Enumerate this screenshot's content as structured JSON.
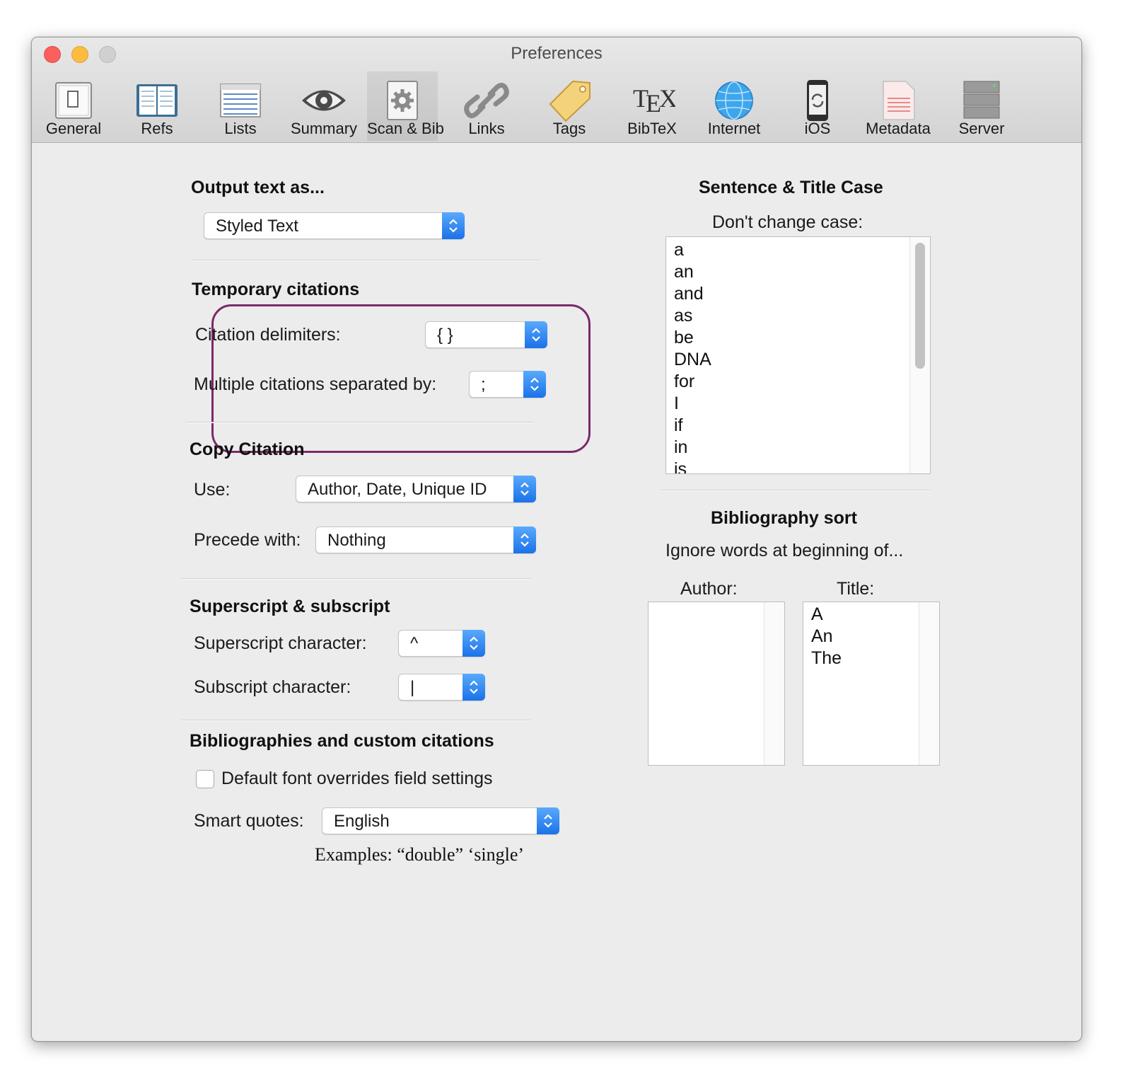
{
  "window": {
    "title": "Preferences"
  },
  "toolbar": [
    {
      "label": "General",
      "icon": "general-icon"
    },
    {
      "label": "Refs",
      "icon": "book-icon"
    },
    {
      "label": "Lists",
      "icon": "list-icon"
    },
    {
      "label": "Summary",
      "icon": "eye-icon"
    },
    {
      "label": "Scan & Bib",
      "icon": "gear-document-icon",
      "selected": true
    },
    {
      "label": "Links",
      "icon": "link-icon"
    },
    {
      "label": "Tags",
      "icon": "tag-icon"
    },
    {
      "label": "BibTeX",
      "icon": "tex-icon"
    },
    {
      "label": "Internet",
      "icon": "globe-icon"
    },
    {
      "label": "iOS",
      "icon": "phone-sync-icon"
    },
    {
      "label": "Metadata",
      "icon": "document-icon"
    },
    {
      "label": "Server",
      "icon": "server-icon"
    }
  ],
  "tex_logo": "TEX",
  "output": {
    "heading": "Output text as...",
    "value": "Styled Text"
  },
  "temporary_citations": {
    "heading": "Temporary citations",
    "delimiters_label": "Citation delimiters:",
    "delimiters_value": "{ }",
    "separator_label": "Multiple citations separated by:",
    "separator_value": ";"
  },
  "copy_citation": {
    "heading": "Copy Citation",
    "use_label": "Use:",
    "use_value": "Author, Date, Unique ID",
    "precede_label": "Precede with:",
    "precede_value": "Nothing"
  },
  "superscript": {
    "heading": "Superscript & subscript",
    "super_label": "Superscript character:",
    "super_value": "^",
    "sub_label": "Subscript character:",
    "sub_value": "|"
  },
  "bibliographies": {
    "heading": "Bibliographies and custom citations",
    "checkbox_label": "Default font overrides field settings",
    "checkbox_checked": false,
    "smart_quotes_label": "Smart quotes:",
    "smart_quotes_value": "English",
    "examples": "Examples:  “double”  ‘single’"
  },
  "sentence_case": {
    "heading": "Sentence & Title Case",
    "subheading": "Don't change case:",
    "words": [
      "a",
      "an",
      "and",
      "as",
      "be",
      "DNA",
      "for",
      "I",
      "if",
      "in",
      "is"
    ]
  },
  "bibliography_sort": {
    "heading": "Bibliography sort",
    "subheading": "Ignore words at beginning of...",
    "author_label": "Author:",
    "author_words": [],
    "title_label": "Title:",
    "title_words": [
      "A",
      "An",
      "The"
    ]
  },
  "colors": {
    "highlight": "#7a2a6a",
    "popup_arrow": "#2a7ff0",
    "close": "#fc605c",
    "minimize": "#fdbc40"
  }
}
